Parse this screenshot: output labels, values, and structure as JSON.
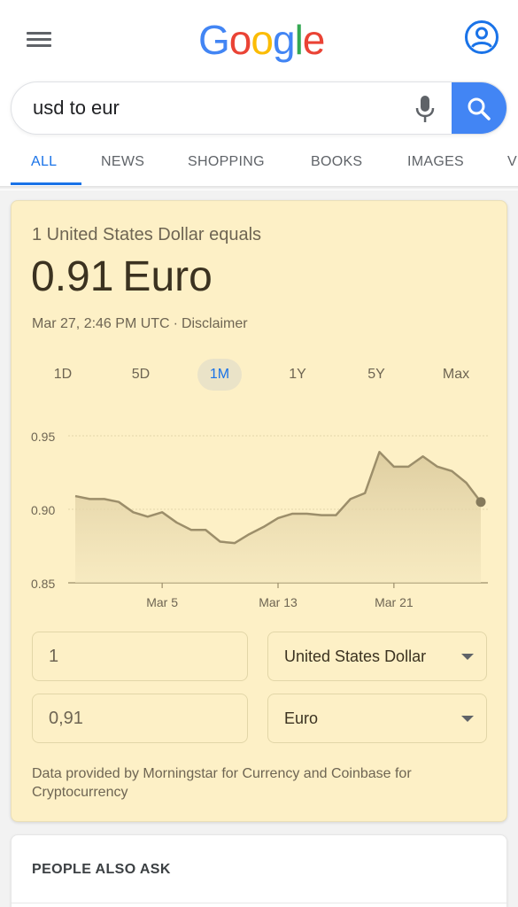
{
  "header": {
    "logo_letters": [
      "G",
      "o",
      "o",
      "g",
      "l",
      "e"
    ],
    "logo_colors": [
      "#4285F4",
      "#EA4335",
      "#FBBC05",
      "#4285F4",
      "#34A853",
      "#EA4335"
    ],
    "menu_icon": "hamburger-menu-icon",
    "account_icon": "account-circle-icon"
  },
  "search": {
    "query": "usd to eur",
    "mic_icon": "microphone-icon",
    "search_icon": "search-icon",
    "accent_color": "#4285F4"
  },
  "tabs": [
    {
      "label": "ALL",
      "active": true
    },
    {
      "label": "NEWS"
    },
    {
      "label": "SHOPPING"
    },
    {
      "label": "BOOKS"
    },
    {
      "label": "IMAGES"
    },
    {
      "label": "V"
    }
  ],
  "converter": {
    "equals_text": "1 United States Dollar equals",
    "result_value": "0.91",
    "result_currency": "Euro",
    "timestamp": "Mar 27, 2:46 PM UTC",
    "separator": "·",
    "disclaimer": "Disclaimer",
    "ranges": [
      {
        "label": "1D"
      },
      {
        "label": "5D"
      },
      {
        "label": "1M",
        "active": true
      },
      {
        "label": "1Y"
      },
      {
        "label": "5Y"
      },
      {
        "label": "Max"
      }
    ],
    "amount_from": "1",
    "currency_from": "United States Dollar",
    "amount_to": "0,91",
    "currency_to": "Euro",
    "attribution": "Data provided by Morningstar for Currency and Coinbase for Cryptocurrency"
  },
  "chart_data": {
    "type": "area",
    "x_tick_labels": [
      "Mar 5",
      "Mar 13",
      "Mar 21"
    ],
    "y_tick_labels": [
      "0.95",
      "0.90",
      "0.85"
    ],
    "ylim": [
      0.85,
      0.95
    ],
    "grid": true,
    "line_color": "#9c8e6a",
    "values": [
      0.909,
      0.907,
      0.907,
      0.905,
      0.898,
      0.895,
      0.898,
      0.891,
      0.886,
      0.886,
      0.878,
      0.877,
      0.883,
      0.888,
      0.894,
      0.897,
      0.897,
      0.896,
      0.896,
      0.907,
      0.911,
      0.939,
      0.929,
      0.929,
      0.936,
      0.929,
      0.926,
      0.918,
      0.905
    ],
    "x_tick_index": [
      6,
      14,
      22
    ]
  },
  "people_also_ask": {
    "title": "PEOPLE ALSO ASK"
  }
}
